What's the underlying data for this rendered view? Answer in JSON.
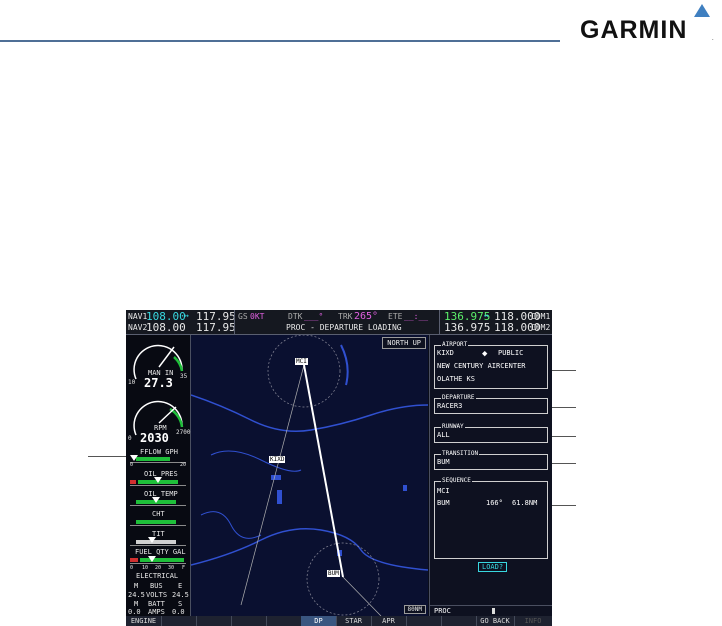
{
  "header": {
    "brand": "GARMIN",
    "brand_mark": "."
  },
  "display": {
    "nav": {
      "nav1_label": "NAV1",
      "nav1_active": "108.00",
      "nav1_standby": "117.95",
      "nav2_label": "NAV2",
      "nav2_active": "108.00",
      "nav2_standby": "117.95",
      "swap_arrow": "↔"
    },
    "status": {
      "gs_label": "GS",
      "gs_value": "0KT",
      "dtk_label": "DTK",
      "dtk_value": "___°",
      "trk_label": "TRK",
      "trk_value": "265°",
      "ete_label": "ETE",
      "ete_value": "__:__",
      "page_title": "PROC - DEPARTURE LOADING"
    },
    "com": {
      "com1_active": "136.975",
      "com1_standby": "118.000",
      "com1_label": "COM1",
      "com2_active": "136.975",
      "com2_standby": "118.000",
      "com2_label": "COM2",
      "swap_arrow": "↔"
    },
    "eis": {
      "man_in_label": "MAN IN",
      "man_in_value": "27.3",
      "man_in_min": "10",
      "man_in_max": "35",
      "rpm_label": "RPM",
      "rpm_value": "2030",
      "rpm_min": "0",
      "rpm_max": "2700",
      "fflow_label": "FFLOW GPH",
      "fflow_min": "0",
      "fflow_max": "20",
      "oil_pres_label": "OIL PRES",
      "oil_temp_label": "OIL TEMP",
      "cht_label": "CHT",
      "tit_label": "TIT",
      "fuel_label": "FUEL QTY GAL",
      "fuel_ticks": [
        "0",
        "10",
        "20",
        "30",
        "F"
      ],
      "electrical_label": "ELECTRICAL",
      "bus_label": "BUS",
      "bus_m": "M",
      "bus_e": "E",
      "volts_label": "VOLTS",
      "volts_m": "24.5",
      "volts_e": "24.5",
      "batt_label": "BATT",
      "batt_m": "M",
      "batt_s": "S",
      "amps_label": "AMPS",
      "amps_m": "0.0",
      "amps_s": "0.0"
    },
    "map": {
      "orientation": "NORTH UP",
      "range": "80NM",
      "wp_mci": "MCI",
      "wp_kixd": "KIXD",
      "wp_bum": "BUM"
    },
    "panel": {
      "airport_title": "AIRPORT",
      "airport_id": "KIXD",
      "airport_type": "PUBLIC",
      "airport_name": "NEW CENTURY AIRCENTER",
      "airport_city": "OLATHE KS",
      "departure_title": "DEPARTURE",
      "departure_value": "RACER3",
      "runway_title": "RUNWAY",
      "runway_value": "ALL",
      "transition_title": "TRANSITION",
      "transition_value": "BUM",
      "sequence_title": "SEQUENCE",
      "sequence": [
        {
          "wpt": "MCI",
          "dtk": "",
          "dist": ""
        },
        {
          "wpt": "BUM",
          "dtk": "166°",
          "dist": "61.8NM"
        }
      ],
      "load_button": "LOAD?",
      "proc_label": "PROC"
    },
    "softkeys": [
      "ENGINE",
      "",
      "",
      "",
      "",
      "DP",
      "STAR",
      "APR",
      "",
      "",
      "GO BACK",
      "INFO"
    ]
  }
}
